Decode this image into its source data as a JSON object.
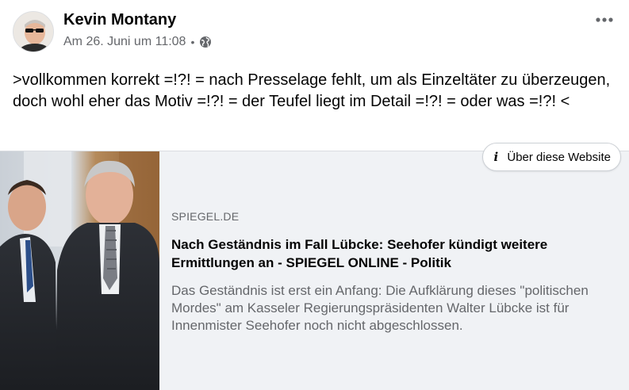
{
  "post": {
    "author": "Kevin Montany",
    "timestamp": "Am 26. Juni um 11:08",
    "separator": "•",
    "privacy_icon": "globe-icon",
    "more_icon": "more-options-icon",
    "text": ">vollkommen korrekt =!?! = nach Presselage fehlt, um als Einzeltäter zu überzeugen, doch wohl eher das Motiv =!?! = der Teufel liegt im Detail =!?! = oder was =!?! <"
  },
  "link_card": {
    "about_button": "Über diese Website",
    "about_icon": "i",
    "domain": "SPIEGEL.DE",
    "title": "Nach Geständnis im Fall Lübcke: Seehofer kündigt weitere Ermittlungen an - SPIEGEL ONLINE - Politik",
    "description": "Das Geständnis ist erst ein Anfang: Die Aufklärung dieses \"politischen Mordes\" am Kasseler Regierungspräsidenten Walter Lübcke ist für Innenmister Seehofer noch nicht abgeschlossen."
  },
  "colors": {
    "card_background": "#f0f2f5",
    "secondary_text": "#65676b",
    "primary_text": "#050505"
  }
}
